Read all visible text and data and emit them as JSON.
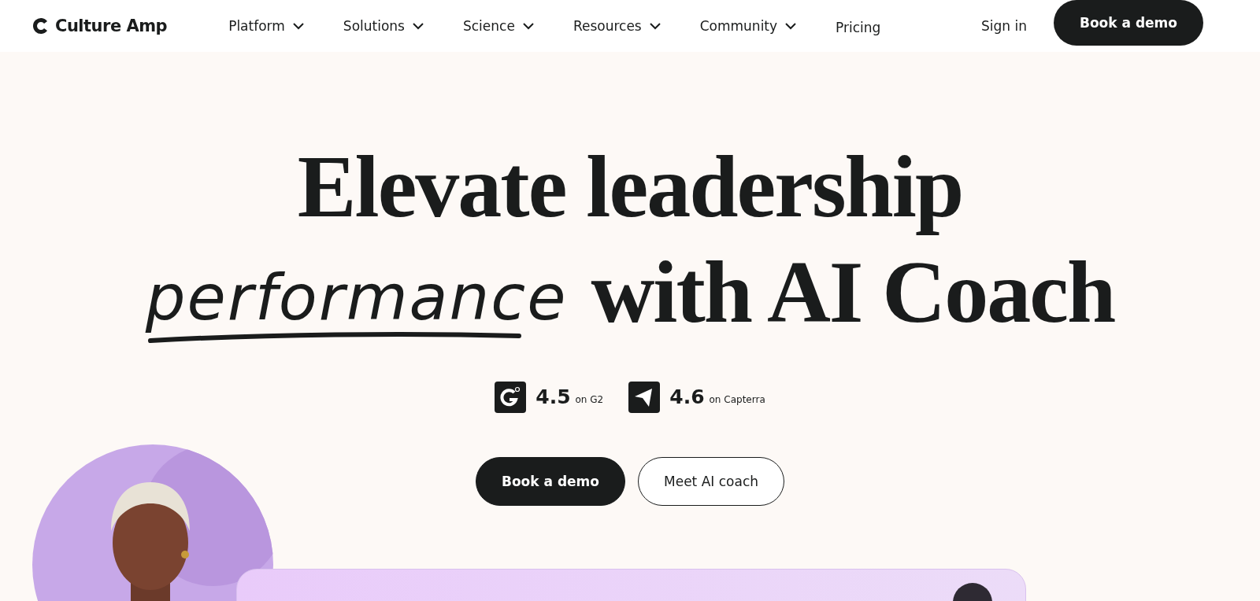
{
  "header": {
    "logo": "Culture Amp",
    "nav": [
      {
        "label": "Platform",
        "dropdown": true
      },
      {
        "label": "Solutions",
        "dropdown": true
      },
      {
        "label": "Science",
        "dropdown": true
      },
      {
        "label": "Resources",
        "dropdown": true
      },
      {
        "label": "Community",
        "dropdown": true
      },
      {
        "label": "Pricing",
        "dropdown": false
      }
    ],
    "sign_in": "Sign in",
    "cta": "Book a demo"
  },
  "hero": {
    "title_line_1": "Elevate leadership",
    "title_script": "performance",
    "title_rest": "with AI Coach",
    "ratings": [
      {
        "kind": "g2",
        "score": "4.5",
        "source": "on G2"
      },
      {
        "kind": "capterra",
        "score": "4.6",
        "source": "on Capterra"
      }
    ],
    "buttons": [
      {
        "label": "Book a demo",
        "kind": "primary"
      },
      {
        "label": "Meet AI coach",
        "kind": "secondary"
      }
    ]
  }
}
